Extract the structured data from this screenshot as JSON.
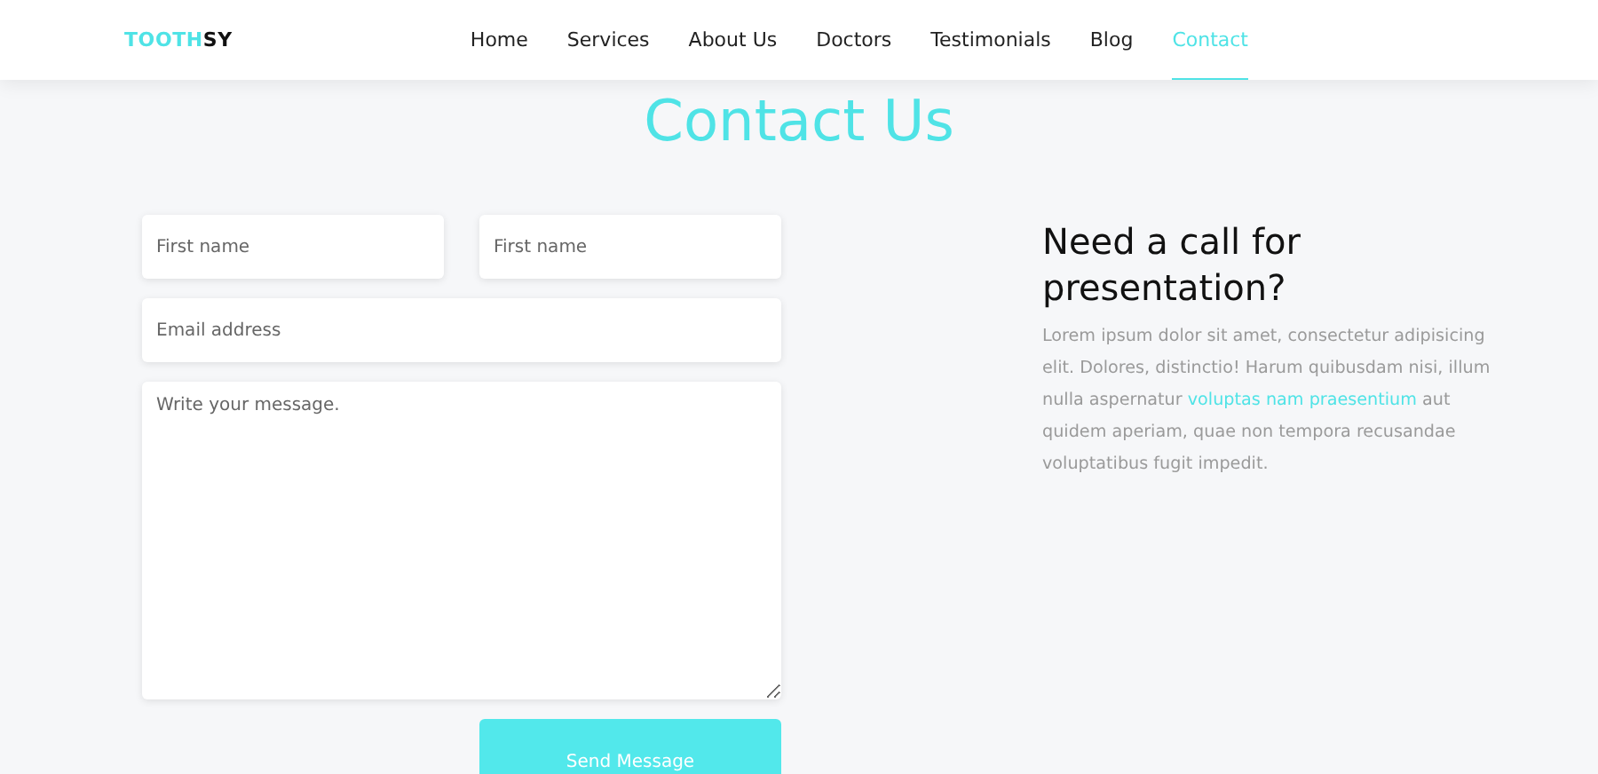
{
  "logo": {
    "parts": [
      {
        "text": "TOOTH",
        "accent": true
      },
      {
        "text": "SY",
        "accent": false
      }
    ]
  },
  "nav": [
    {
      "label": "Home",
      "selected": false
    },
    {
      "label": "Services",
      "selected": false
    },
    {
      "label": "About Us",
      "selected": false
    },
    {
      "label": "Doctors",
      "selected": false
    },
    {
      "label": "Testimonials",
      "selected": false
    },
    {
      "label": "Blog",
      "selected": false
    },
    {
      "label": "Contact",
      "selected": true
    }
  ],
  "title": "Contact Us",
  "form": {
    "fields": [
      {
        "kind": "short",
        "placeholder": "First name"
      },
      {
        "kind": "short",
        "placeholder": "First name"
      },
      {
        "kind": "wide",
        "placeholder": "Email address"
      },
      {
        "kind": "message",
        "placeholder": "Write your message."
      }
    ],
    "button": "Send Message"
  },
  "info": {
    "heading": "Need a call for presentation?",
    "paragraph": [
      {
        "kind": "text",
        "text": "Lorem ipsum dolor sit amet, consectetur adipisicing elit. Dolores, distinctio! Harum quibusdam nisi, illum nulla aspernatur "
      },
      {
        "kind": "link",
        "text": "voluptas"
      },
      {
        "kind": "link",
        "text": "nam praesentium"
      },
      {
        "kind": "text",
        "text": " aut quidem aperiam, quae non tempora recusandae voluptatibus fugit impedit."
      }
    ]
  }
}
